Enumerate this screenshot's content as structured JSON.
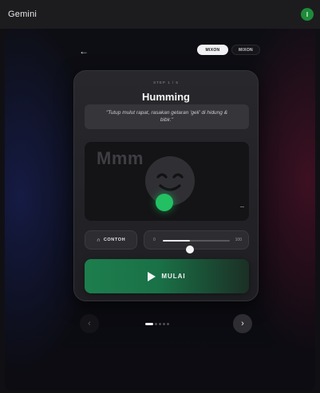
{
  "app": {
    "title": "Gemini",
    "avatar_initial": "I"
  },
  "header": {
    "back_icon": "arrow-left-icon",
    "modes": [
      {
        "label": "MIXON",
        "active": true
      },
      {
        "label": "MIXON",
        "active": false
      }
    ]
  },
  "card": {
    "step_label": "STEP 1 / 5",
    "title": "Humming",
    "instruction": "\"Tutup mulut rapat, rasakan getaran 'geli' di hidung & bibir.\"",
    "visual": {
      "caption": "Mmm",
      "face_icon": "smiling-face-icon"
    },
    "example_button": {
      "icon": "headphones-icon",
      "label": "CONTOH"
    },
    "volume": {
      "min_label": "0",
      "max_label": "100",
      "level": 0.4
    },
    "start_button": {
      "icon": "play-icon",
      "label": "MULAI"
    }
  },
  "pager": {
    "prev_icon": "chevron-left-icon",
    "next_icon": "chevron-right-icon",
    "total": 5,
    "current": 1
  },
  "colors": {
    "accent_green": "#22c063",
    "start_gradient_start": "#1d7e4d",
    "background": "#101014"
  }
}
